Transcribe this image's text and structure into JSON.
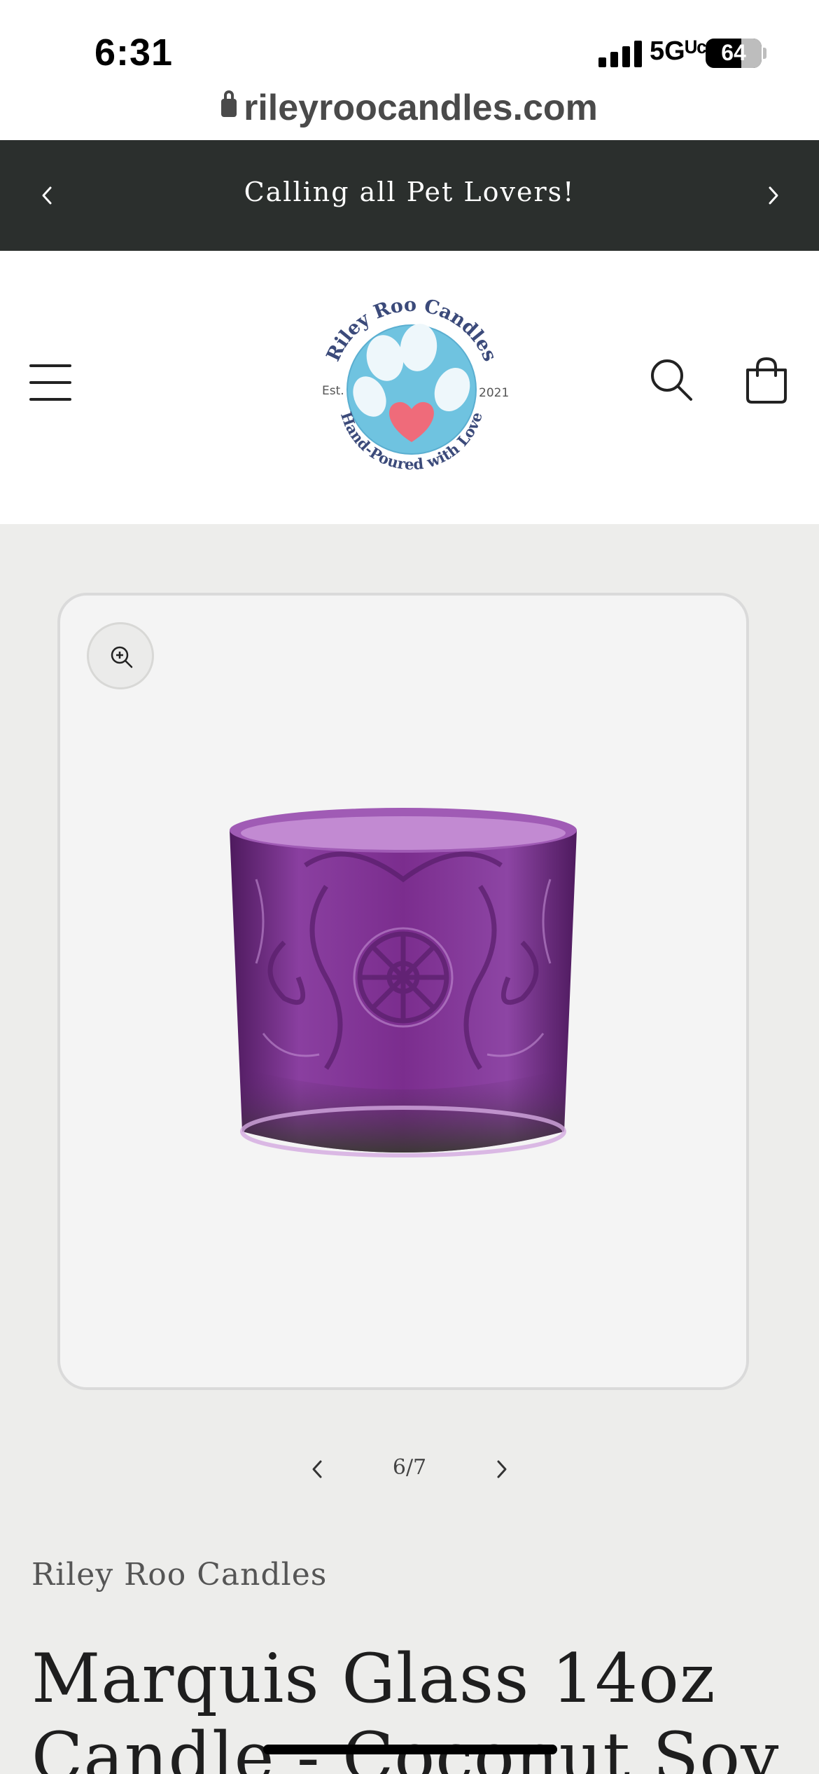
{
  "status_bar": {
    "time": "6:31",
    "network": "5Gᵁᶜ",
    "battery": "64",
    "battery_level": 0.64
  },
  "browser": {
    "url": "rileyroocandles.com"
  },
  "announcement": {
    "text": "Calling all Pet Lovers!"
  },
  "header": {
    "logo": {
      "top_text": "Riley Roo Candles",
      "bottom_text": "Hand-Poured with Love",
      "left_text": "Est.",
      "right_text": "2021"
    }
  },
  "gallery": {
    "counter": "6/7"
  },
  "product": {
    "vendor": "Riley Roo Candles",
    "title": "Marquis Glass 14oz Candle - Coconut Soy"
  },
  "colors": {
    "announcement_bg": "#2b2f2d",
    "page_bg": "#ededeb",
    "glass_purple": "#7b2d8e"
  }
}
